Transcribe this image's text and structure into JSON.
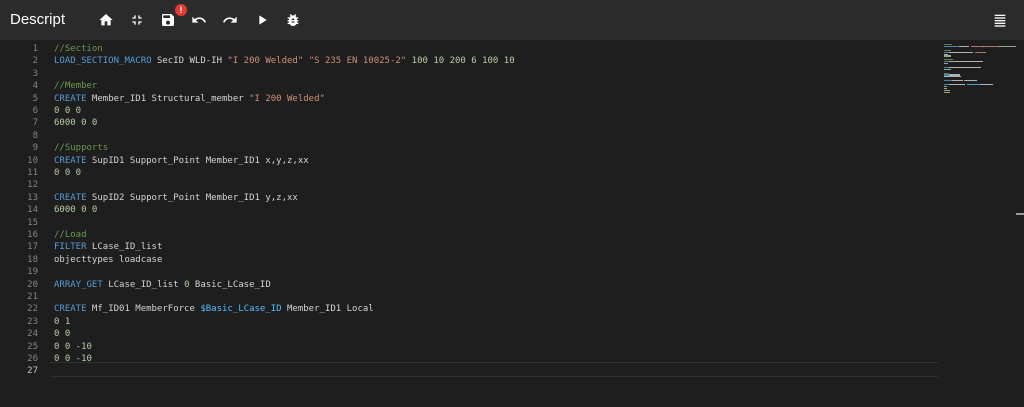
{
  "app": {
    "title": "Descript"
  },
  "toolbar": {
    "buttons": [
      {
        "icon": "home-icon",
        "name": "home-button"
      },
      {
        "icon": "collapse-icon",
        "name": "collapse-button"
      },
      {
        "icon": "save-icon",
        "name": "save-button"
      },
      {
        "icon": "undo-icon",
        "name": "undo-button"
      },
      {
        "icon": "redo-icon",
        "name": "redo-button"
      },
      {
        "icon": "play-icon",
        "name": "run-button"
      },
      {
        "icon": "bug-icon",
        "name": "debug-button"
      }
    ],
    "save_badge": "!",
    "menu_icon": "list-icon"
  },
  "colors": {
    "background": "#1e1e1e",
    "toolbar": "#2b2b2b",
    "comment": "#6a9955",
    "keyword": "#569cd6",
    "string": "#ce9178",
    "number": "#b5cea8",
    "variable": "#4fc1ff",
    "badge": "#e53935"
  },
  "editor": {
    "line_numbers": [
      "1",
      "2",
      "3",
      "4",
      "5",
      "6",
      "7",
      "8",
      "9",
      "10",
      "11",
      "12",
      "13",
      "14",
      "15",
      "16",
      "17",
      "18",
      "19",
      "20",
      "21",
      "22",
      "23",
      "24",
      "25",
      "26",
      "27"
    ],
    "active_line": "27",
    "lines": [
      [
        {
          "t": "comment",
          "v": "//Section"
        }
      ],
      [
        {
          "t": "keyword",
          "v": "LOAD_SECTION_MACRO"
        },
        {
          "t": "plain",
          "v": " SecID WLD-IH "
        },
        {
          "t": "string",
          "v": "\"I 200 Welded\""
        },
        {
          "t": "plain",
          "v": " "
        },
        {
          "t": "string",
          "v": "\"S 235 EN 10025-2\""
        },
        {
          "t": "plain",
          "v": " "
        },
        {
          "t": "number",
          "v": "100 10 200 6 100 10"
        }
      ],
      [],
      [
        {
          "t": "comment",
          "v": "//Member"
        }
      ],
      [
        {
          "t": "keyword",
          "v": "CREATE"
        },
        {
          "t": "plain",
          "v": " Member_ID1 Structural_member "
        },
        {
          "t": "string",
          "v": "\"I 200 Welded\""
        }
      ],
      [
        {
          "t": "number",
          "v": "0 0 0"
        }
      ],
      [
        {
          "t": "number",
          "v": "6000 0 0"
        }
      ],
      [],
      [
        {
          "t": "comment",
          "v": "//Supports"
        }
      ],
      [
        {
          "t": "keyword",
          "v": "CREATE"
        },
        {
          "t": "plain",
          "v": " SupID1 Support_Point Member_ID1 x,y,z,xx"
        }
      ],
      [
        {
          "t": "number",
          "v": "0 0 0"
        }
      ],
      [],
      [
        {
          "t": "keyword",
          "v": "CREATE"
        },
        {
          "t": "plain",
          "v": " SupID2 Support_Point Member_ID1 y,z,xx"
        }
      ],
      [
        {
          "t": "number",
          "v": "6000 0 0"
        }
      ],
      [],
      [
        {
          "t": "comment",
          "v": "//Load"
        }
      ],
      [
        {
          "t": "keyword",
          "v": "FILTER"
        },
        {
          "t": "plain",
          "v": " LCase_ID_list"
        }
      ],
      [
        {
          "t": "plain",
          "v": "objecttypes loadcase"
        }
      ],
      [],
      [
        {
          "t": "keyword",
          "v": "ARRAY_GET"
        },
        {
          "t": "plain",
          "v": " LCase_ID_list "
        },
        {
          "t": "number",
          "v": "0"
        },
        {
          "t": "plain",
          "v": " Basic_LCase_ID"
        }
      ],
      [],
      [
        {
          "t": "keyword",
          "v": "CREATE"
        },
        {
          "t": "plain",
          "v": " Mf_ID01 MemberForce "
        },
        {
          "t": "variable",
          "v": "$Basic_LCase_ID"
        },
        {
          "t": "plain",
          "v": " Member_ID1 Local"
        }
      ],
      [
        {
          "t": "number",
          "v": "0 1"
        }
      ],
      [
        {
          "t": "number",
          "v": "0 0"
        }
      ],
      [
        {
          "t": "number",
          "v": "0 0 -10"
        }
      ],
      [
        {
          "t": "number",
          "v": "0 0 -10"
        }
      ],
      []
    ]
  }
}
